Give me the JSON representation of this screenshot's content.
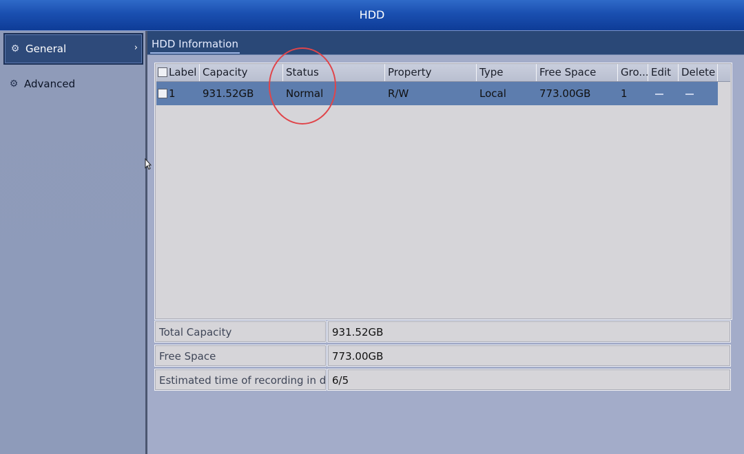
{
  "window": {
    "title": "HDD"
  },
  "sidebar": {
    "items": [
      {
        "label": "General",
        "icon": "gear-icon",
        "active": true
      },
      {
        "label": "Advanced",
        "icon": "gear-icon",
        "active": false
      }
    ]
  },
  "tabs": [
    {
      "label": "HDD Information",
      "active": true
    }
  ],
  "table": {
    "columns": [
      "Label",
      "Capacity",
      "Status",
      "Property",
      "Type",
      "Free Space",
      "Gro...",
      "Edit",
      "Delete"
    ],
    "rows": [
      {
        "label": "1",
        "capacity": "931.52GB",
        "status": "Normal",
        "property": "R/W",
        "type": "Local",
        "free_space": "773.00GB",
        "group": "1"
      }
    ]
  },
  "summary": [
    {
      "label": "Total Capacity",
      "value": "931.52GB"
    },
    {
      "label": "Free Space",
      "value": "773.00GB"
    },
    {
      "label": "Estimated time of recording in d...",
      "value": "6/5"
    }
  ],
  "colors": {
    "title_bar": "#1a4fb0",
    "selected_row": "#5d7dae",
    "annotation_circle": "#e0454a"
  }
}
